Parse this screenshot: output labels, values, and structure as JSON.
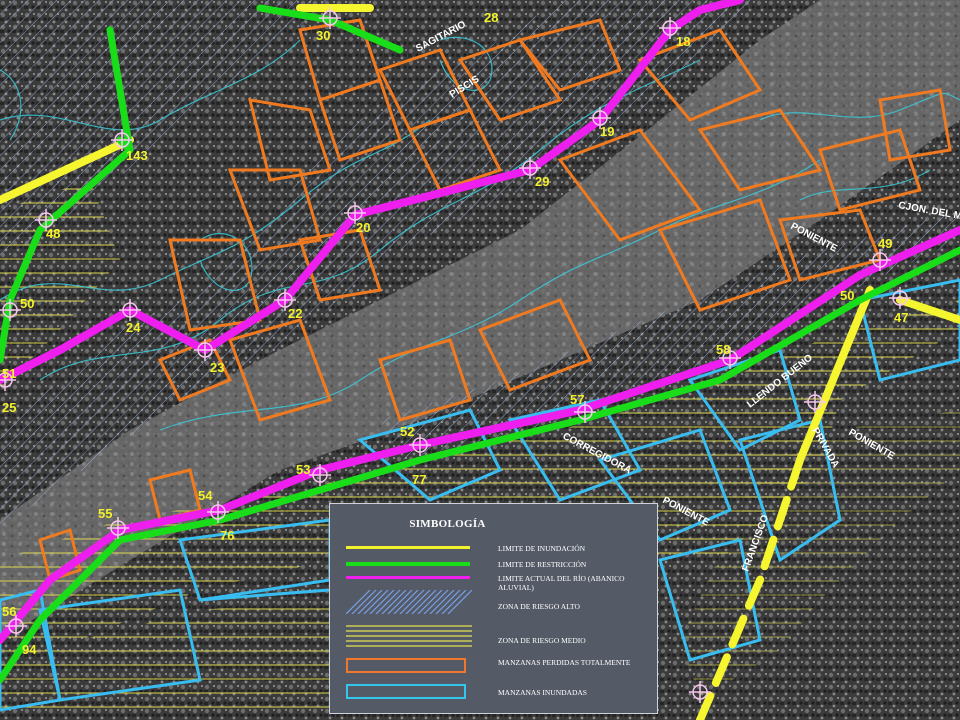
{
  "map": {
    "street_labels": [
      "SAGITARIO",
      "PISCIS",
      "PONIENTE",
      "CJON. DEL MURO",
      "PONIENTE",
      "LLENDO BUENO",
      "PRIVADA",
      "PONIENTE",
      "CORREGIDORA",
      "FRANCISCO",
      "PONIENTE",
      "SUR 1",
      "PONIENTE",
      "PRIMERA",
      "CALLE"
    ],
    "point_labels": [
      "30",
      "28",
      "18",
      "19",
      "29",
      "20",
      "22",
      "23",
      "24",
      "143",
      "48",
      "50",
      "51",
      "25",
      "49",
      "47",
      "52",
      "53",
      "54",
      "55",
      "56",
      "57",
      "58",
      "76",
      "77",
      "94",
      "50"
    ]
  },
  "legend": {
    "title": "SIMBOLOGÍA",
    "items": [
      {
        "label": "LIMITE DE INUNDACIÓN",
        "color": "#f2f22c"
      },
      {
        "label": "LIMITE DE RESTRICCIÓN",
        "color": "#19dd19"
      },
      {
        "label": "LIMITE ACTUAL DEL RÍO (ABANICO ALUVIAL)",
        "color": "#ee1fee"
      },
      {
        "label": "ZONA DE RIESGO ALTO",
        "color": "#6b8fd6"
      },
      {
        "label": "ZONA DE RIESGO MEDIO",
        "color": "#e8e050"
      },
      {
        "label": "MANZANAS PERDIDAS TOTALMENTE",
        "color": "#f0782a"
      },
      {
        "label": "MANZANAS INUNDADAS",
        "color": "#33c7ec"
      }
    ]
  }
}
